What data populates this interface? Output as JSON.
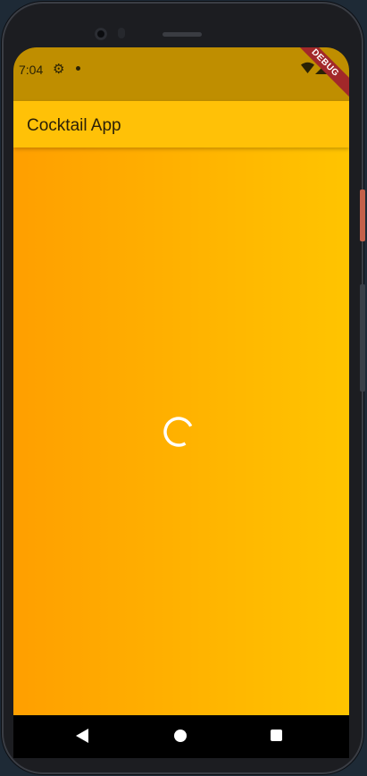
{
  "status_bar": {
    "time": "7:04",
    "icons": [
      "settings-gear-icon",
      "notification-dot-icon",
      "wifi-icon",
      "cell-signal-icon",
      "battery-icon"
    ]
  },
  "debug_banner": {
    "label": "DEBUG",
    "color": "#a2282a"
  },
  "app_bar": {
    "title": "Cocktail App",
    "color": "#ffc107"
  },
  "content": {
    "gradient_colors": [
      "#ff9f00",
      "#ffc400"
    ],
    "loading_indicator": "circular-progress-icon"
  },
  "nav_bar": {
    "buttons": [
      "back-icon",
      "home-icon",
      "recents-icon"
    ]
  }
}
